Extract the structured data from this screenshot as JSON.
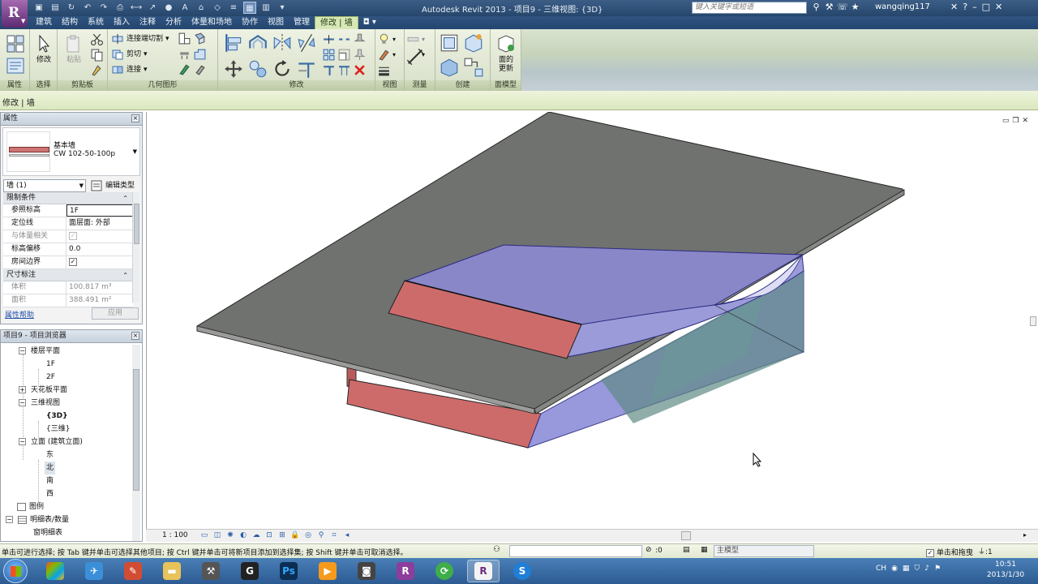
{
  "window": {
    "title": "Autodesk Revit 2013 -    项目9 - 三维视图: {3D}",
    "search_placeholder": "键入关键字或短语",
    "username": "wangqing117"
  },
  "tabs": [
    {
      "label": "建筑"
    },
    {
      "label": "结构"
    },
    {
      "label": "系统"
    },
    {
      "label": "插入"
    },
    {
      "label": "注释"
    },
    {
      "label": "分析"
    },
    {
      "label": "体量和场地"
    },
    {
      "label": "协作"
    },
    {
      "label": "视图"
    },
    {
      "label": "管理"
    },
    {
      "label": "修改 | 墙",
      "active": true
    }
  ],
  "ribbon": {
    "panels": {
      "properties": "属性",
      "select": "选择",
      "clipboard": "剪贴板",
      "geometry": "几何图形",
      "modify": "修改",
      "view": "视图",
      "measure": "测量",
      "create": "创建",
      "face_model": "面模型"
    },
    "buttons": {
      "modify": "修改",
      "paste": "粘贴",
      "join_cut": "连接端切割",
      "cut": "剪切",
      "join": "连接",
      "update_face_line1": "面的",
      "update_face_line2": "更新"
    }
  },
  "options_bar": {
    "context": "修改 | 墙"
  },
  "properties": {
    "header": "属性",
    "type_family": "基本墙",
    "type_name": "CW 102-50-100p",
    "instance_filter": "墙 (1)",
    "edit_type": "编辑类型",
    "groups": [
      {
        "label": "限制条件",
        "rows": [
          {
            "key": "参照标高",
            "value": "1F",
            "editing": true
          },
          {
            "key": "定位线",
            "value": "面层面: 外部"
          },
          {
            "key": "与体量相关",
            "check": true,
            "disabled": true
          },
          {
            "key": "标高偏移",
            "value": "0.0"
          },
          {
            "key": "房间边界",
            "check": true
          }
        ]
      },
      {
        "label": "尺寸标注",
        "rows": [
          {
            "key": "体积",
            "value": "100.817 m³",
            "disabled": true
          },
          {
            "key": "面积",
            "value": "388.491 m²",
            "disabled": true
          }
        ]
      }
    ],
    "help_link": "属性帮助",
    "apply_label": "应用",
    "collapse_glyph": "⌃"
  },
  "browser": {
    "header": "项目9 - 项目浏览器",
    "nodes": [
      {
        "label": "楼层平面",
        "level": 1,
        "toggle": "−"
      },
      {
        "label": "1F",
        "level": 2
      },
      {
        "label": "2F",
        "level": 2
      },
      {
        "label": "天花板平面",
        "level": 1,
        "toggle": "+"
      },
      {
        "label": "三维视图",
        "level": 1,
        "toggle": "−"
      },
      {
        "label": "{3D}",
        "level": 2,
        "bold": true
      },
      {
        "label": "{三维}",
        "level": 2
      },
      {
        "label": "立面 (建筑立面)",
        "level": 1,
        "toggle": "−"
      },
      {
        "label": "东",
        "level": 2
      },
      {
        "label": "北",
        "level": 2,
        "selected": true
      },
      {
        "label": "南",
        "level": 2
      },
      {
        "label": "西",
        "level": 2
      },
      {
        "label": "图例",
        "level": 0,
        "icon": true
      },
      {
        "label": "明细表/数量",
        "level": 0,
        "icon": true,
        "toggle": "−"
      },
      {
        "label": "窗明细表",
        "level": 1
      }
    ]
  },
  "view": {
    "scale": "1 : 100"
  },
  "status": {
    "hint": "单击可进行选择; 按 Tab 键并单击可选择其他项目; 按 Ctrl 键并单击可将新项目添加到选择集; 按 Shift 键并单击可取消选择。",
    "zero": ":0",
    "model": "主模型",
    "drag": "单击和拖曳",
    "filter": ":1"
  },
  "taskbar": {
    "lang": "CH",
    "time": "10:51",
    "date": "2013/1/30"
  },
  "colors": {
    "wall_red": "#cd6b6b",
    "roof_gray": "#6f716e",
    "mass_blue": "#8d8dd9",
    "mass_teal": "#5f8a85",
    "ribbon_green": "#dbe6c2"
  }
}
